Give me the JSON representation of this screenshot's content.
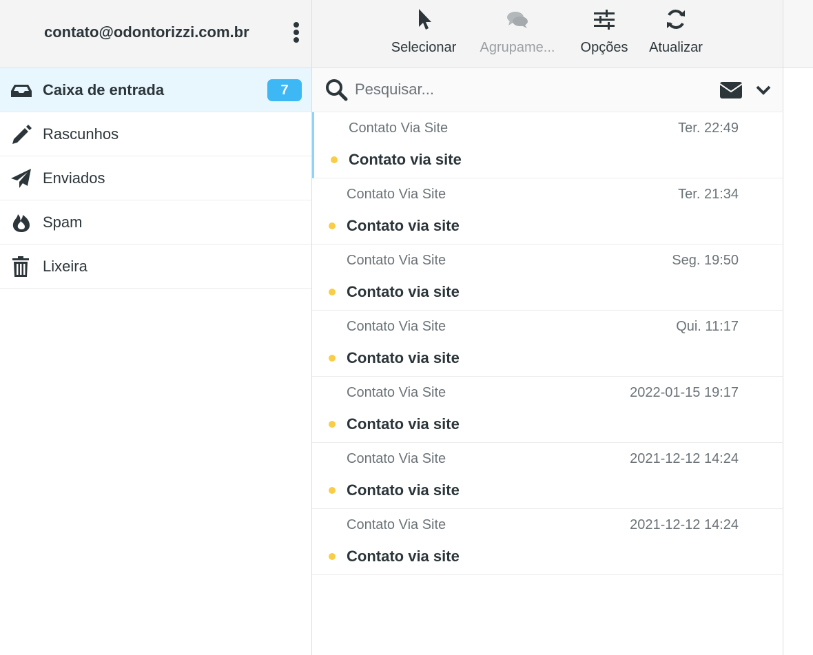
{
  "account": {
    "email": "contato@odontorizzi.com.br",
    "menu_icon": "kebab-icon"
  },
  "toolbar": {
    "items": [
      {
        "label": "Selecionar",
        "icon": "pointer-icon",
        "disabled": false
      },
      {
        "label": "Agrupame...",
        "icon": "comments-icon",
        "disabled": true
      },
      {
        "label": "Opções",
        "icon": "sliders-icon",
        "disabled": false
      },
      {
        "label": "Atualizar",
        "icon": "refresh-icon",
        "disabled": false
      }
    ]
  },
  "sidebar": {
    "folders": [
      {
        "label": "Caixa de entrada",
        "icon": "inbox-icon",
        "badge": "7",
        "active": true
      },
      {
        "label": "Rascunhos",
        "icon": "pencil-icon"
      },
      {
        "label": "Enviados",
        "icon": "paper-plane-icon"
      },
      {
        "label": "Spam",
        "icon": "fire-icon"
      },
      {
        "label": "Lixeira",
        "icon": "trash-icon"
      }
    ]
  },
  "search": {
    "placeholder": "Pesquisar..."
  },
  "messages": [
    {
      "sender": "Contato Via Site",
      "date": "Ter. 22:49",
      "subject": "Contato via site"
    },
    {
      "sender": "Contato Via Site",
      "date": "Ter. 21:34",
      "subject": "Contato via site"
    },
    {
      "sender": "Contato Via Site",
      "date": "Seg. 19:50",
      "subject": "Contato via site"
    },
    {
      "sender": "Contato Via Site",
      "date": "Qui. 11:17",
      "subject": "Contato via site"
    },
    {
      "sender": "Contato Via Site",
      "date": "2022-01-15 19:17",
      "subject": "Contato via site"
    },
    {
      "sender": "Contato Via Site",
      "date": "2021-12-12 14:24",
      "subject": "Contato via site"
    },
    {
      "sender": "Contato Via Site",
      "date": "2021-12-12 14:24",
      "subject": "Contato via site"
    }
  ],
  "colors": {
    "accent": "#3db8f5",
    "unread_dot": "#f9cd46",
    "active_folder_bg": "#e8f6fd",
    "text": "#2c363a"
  }
}
